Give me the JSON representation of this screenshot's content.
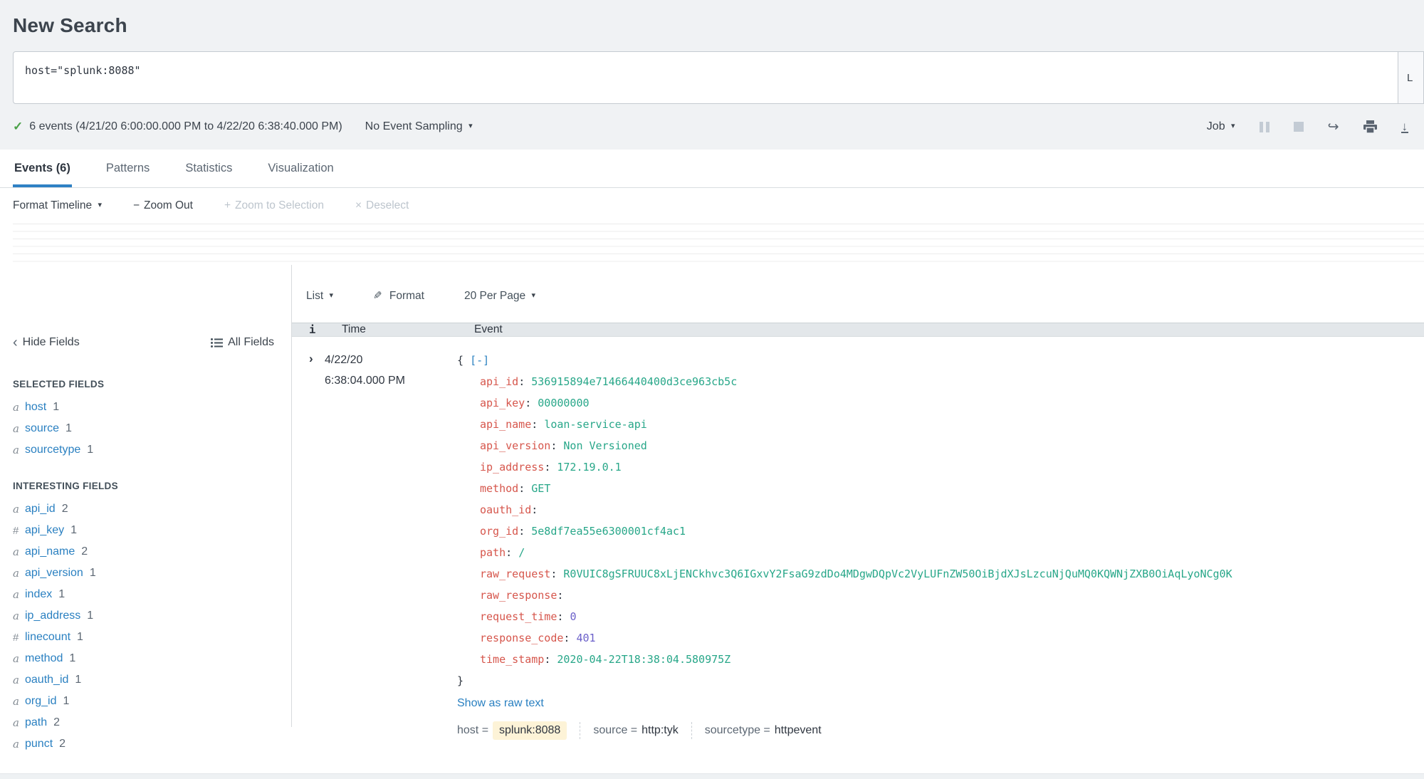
{
  "colors": {
    "accent_blue": "#2a80c1",
    "tab_underline": "#2f81c4",
    "key_red": "#d6564c",
    "string_green": "#28a789",
    "number_purple": "#6a5fc9",
    "check_green": "#4aa147",
    "highlight_yellow": "#fdf3d7",
    "header_bg": "#f0f2f4",
    "table_header_bg": "#e3e7ea"
  },
  "header": {
    "title": "New Search",
    "search_query": "host=\"splunk:8088\"",
    "time_range_label": "L",
    "events_summary": "6 events (4/21/20 6:00:00.000 PM to 4/22/20 6:38:40.000 PM)",
    "sampling_label": "No Event Sampling",
    "job_label": "Job",
    "check_icon": "✓",
    "caret_icon": "▾",
    "share_icon": "↪",
    "download_icon": "↓"
  },
  "tabs": [
    {
      "label": "Events (6)",
      "active": true
    },
    {
      "label": "Patterns",
      "active": false
    },
    {
      "label": "Statistics",
      "active": false
    },
    {
      "label": "Visualization",
      "active": false
    }
  ],
  "timeline_controls": {
    "format_timeline": "Format Timeline",
    "zoom_out": "Zoom Out",
    "zoom_out_sym": "−",
    "zoom_to_selection": "Zoom to Selection",
    "zoom_to_selection_sym": "+",
    "deselect": "Deselect",
    "deselect_sym": "×"
  },
  "results_controls": {
    "list_label": "List",
    "format_label": "Format",
    "format_icon": "✎",
    "per_page_label": "20 Per Page"
  },
  "fields_panel": {
    "hide_fields": "Hide Fields",
    "hide_chevron": "‹",
    "all_fields": "All Fields",
    "selected_heading": "SELECTED FIELDS",
    "interesting_heading": "INTERESTING FIELDS",
    "selected": [
      {
        "type": "a",
        "name": "host",
        "count": "1"
      },
      {
        "type": "a",
        "name": "source",
        "count": "1"
      },
      {
        "type": "a",
        "name": "sourcetype",
        "count": "1"
      }
    ],
    "interesting": [
      {
        "type": "a",
        "name": "api_id",
        "count": "2"
      },
      {
        "type": "#",
        "name": "api_key",
        "count": "1"
      },
      {
        "type": "a",
        "name": "api_name",
        "count": "2"
      },
      {
        "type": "a",
        "name": "api_version",
        "count": "1"
      },
      {
        "type": "a",
        "name": "index",
        "count": "1"
      },
      {
        "type": "a",
        "name": "ip_address",
        "count": "1"
      },
      {
        "type": "#",
        "name": "linecount",
        "count": "1"
      },
      {
        "type": "a",
        "name": "method",
        "count": "1"
      },
      {
        "type": "a",
        "name": "oauth_id",
        "count": "1"
      },
      {
        "type": "a",
        "name": "org_id",
        "count": "1"
      },
      {
        "type": "a",
        "name": "path",
        "count": "2"
      },
      {
        "type": "a",
        "name": "punct",
        "count": "2"
      }
    ]
  },
  "table": {
    "col_info": "i",
    "col_time": "Time",
    "col_event": "Event"
  },
  "event": {
    "expand_chevron": "›",
    "date": "4/22/20",
    "time": "6:38:04.000 PM",
    "open_brace": "{",
    "close_brace": "}",
    "collapse_label": "[-]",
    "json_fields": [
      {
        "key": "api_id",
        "value": "536915894e71466440400d3ce963cb5c",
        "type": "string"
      },
      {
        "key": "api_key",
        "value": "00000000",
        "type": "string"
      },
      {
        "key": "api_name",
        "value": "loan-service-api",
        "type": "string"
      },
      {
        "key": "api_version",
        "value": "Non Versioned",
        "type": "string"
      },
      {
        "key": "ip_address",
        "value": "172.19.0.1",
        "type": "string"
      },
      {
        "key": "method",
        "value": "GET",
        "type": "string"
      },
      {
        "key": "oauth_id",
        "value": "",
        "type": "empty"
      },
      {
        "key": "org_id",
        "value": "5e8df7ea55e6300001cf4ac1",
        "type": "string"
      },
      {
        "key": "path",
        "value": "/",
        "type": "string"
      },
      {
        "key": "raw_request",
        "value": "R0VUIC8gSFRUUC8xLjENCkhvc3Q6IGxvY2FsaG9zdDo4MDgwDQpVc2VyLUFnZW50OiBjdXJsLzcuNjQuMQ0KQWNjZXB0OiAqLyoNCg0K",
        "type": "string"
      },
      {
        "key": "raw_response",
        "value": "",
        "type": "empty"
      },
      {
        "key": "request_time",
        "value": "0",
        "type": "number"
      },
      {
        "key": "response_code",
        "value": "401",
        "type": "number"
      },
      {
        "key": "time_stamp",
        "value": "2020-04-22T18:38:04.580975Z",
        "type": "string"
      }
    ],
    "show_raw": "Show as raw text",
    "meta": [
      {
        "label": "host",
        "value": "splunk:8088",
        "highlight": true
      },
      {
        "label": "source",
        "value": "http:tyk",
        "highlight": false
      },
      {
        "label": "sourcetype",
        "value": "httpevent",
        "highlight": false
      }
    ]
  }
}
